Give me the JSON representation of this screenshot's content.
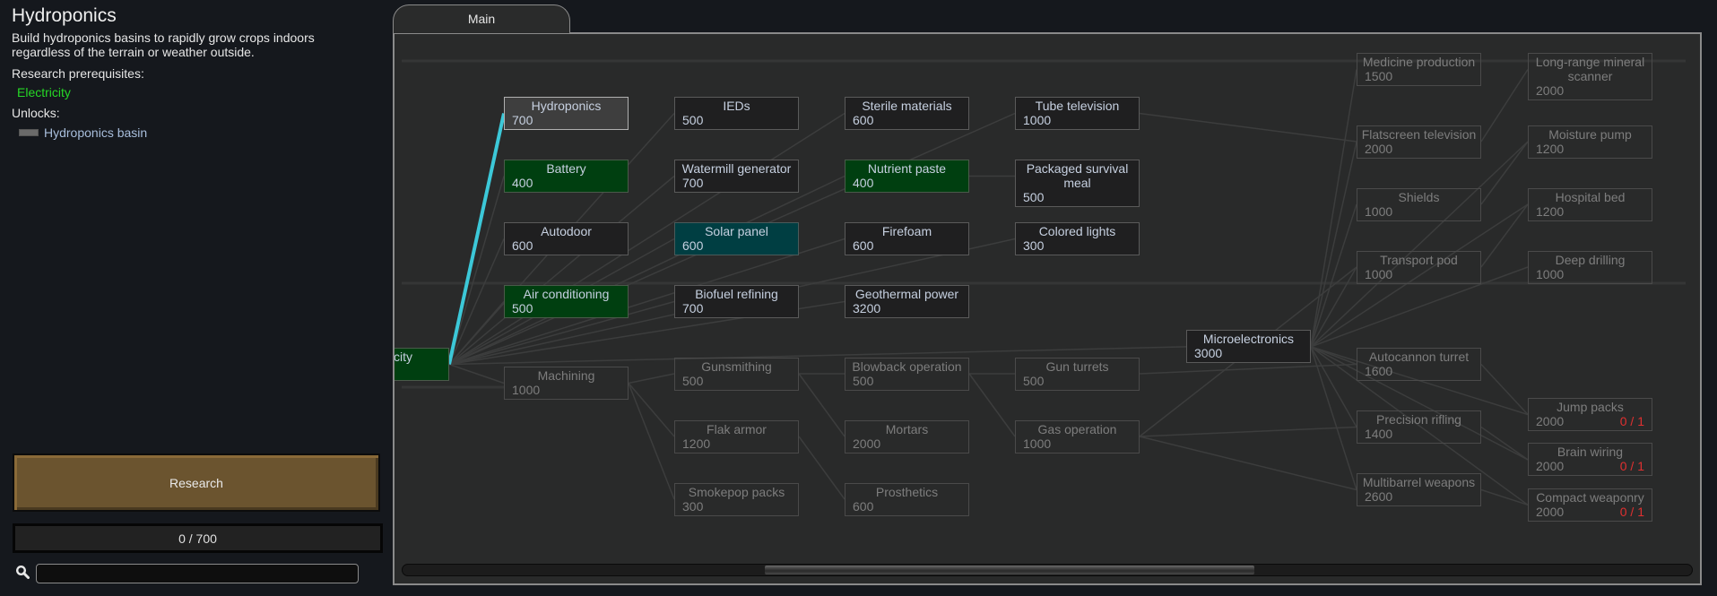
{
  "info": {
    "title": "Hydroponics",
    "description": "Build hydroponics basins to rapidly grow crops indoors regardless of the terrain or weather outside.",
    "prerequisites_label": "Research prerequisites:",
    "prerequisites": [
      "Electricity"
    ],
    "unlocks_label": "Unlocks:",
    "unlocks": [
      "Hydroponics basin"
    ],
    "research_button": "Research",
    "progress_text": "0 / 700",
    "progress_value": 0,
    "progress_max": 700,
    "search_placeholder": "",
    "search_value": ""
  },
  "tabs": [
    {
      "label": "Main",
      "active": true
    }
  ],
  "colors": {
    "prereq_green": "#26d826",
    "done": "#003f10",
    "available_teal": "#003e42",
    "selected": "#3e3e3e",
    "edge": "#3c3d3d",
    "selected_edge": "#3cc8d8",
    "requirement_red": "#e03030",
    "research_button": "#6b542f"
  },
  "scroll": {
    "position_fraction": 0.28,
    "visible_fraction": 0.38
  },
  "nodes": [
    {
      "id": "electricity",
      "label": "Electricity",
      "cost": "",
      "state": "done",
      "col": 0,
      "row": 4.0,
      "clipped": true
    },
    {
      "id": "hydroponics",
      "label": "Hydroponics",
      "cost": "700",
      "state": "selected",
      "col": 1,
      "row": 0
    },
    {
      "id": "battery",
      "label": "Battery",
      "cost": "400",
      "state": "done",
      "col": 1,
      "row": 1
    },
    {
      "id": "autodoor",
      "label": "Autodoor",
      "cost": "600",
      "state": "available",
      "col": 1,
      "row": 2
    },
    {
      "id": "air-conditioning",
      "label": "Air conditioning",
      "cost": "500",
      "state": "done",
      "col": 1,
      "row": 3
    },
    {
      "id": "machining",
      "label": "Machining",
      "cost": "1000",
      "state": "locked",
      "col": 1,
      "row": 4.3
    },
    {
      "id": "ieds",
      "label": "IEDs",
      "cost": "500",
      "state": "available",
      "col": 2,
      "row": 0
    },
    {
      "id": "watermill-generator",
      "label": "Watermill generator",
      "cost": "700",
      "state": "available",
      "col": 2,
      "row": 1
    },
    {
      "id": "solar-panel",
      "label": "Solar panel",
      "cost": "600",
      "state": "active",
      "col": 2,
      "row": 2
    },
    {
      "id": "biofuel-refining",
      "label": "Biofuel refining",
      "cost": "700",
      "state": "available",
      "col": 2,
      "row": 3
    },
    {
      "id": "gunsmithing",
      "label": "Gunsmithing",
      "cost": "500",
      "state": "locked",
      "col": 2,
      "row": 4.15
    },
    {
      "id": "flak-armor",
      "label": "Flak armor",
      "cost": "1200",
      "state": "locked",
      "col": 2,
      "row": 5.15
    },
    {
      "id": "smokepop-packs",
      "label": "Smokepop packs",
      "cost": "300",
      "state": "locked",
      "col": 2,
      "row": 6.15
    },
    {
      "id": "sterile-materials",
      "label": "Sterile materials",
      "cost": "600",
      "state": "available",
      "col": 3,
      "row": 0
    },
    {
      "id": "nutrient-paste",
      "label": "Nutrient paste",
      "cost": "400",
      "state": "done",
      "col": 3,
      "row": 1
    },
    {
      "id": "firefoam",
      "label": "Firefoam",
      "cost": "600",
      "state": "available",
      "col": 3,
      "row": 2
    },
    {
      "id": "geothermal-power",
      "label": "Geothermal power",
      "cost": "3200",
      "state": "available",
      "col": 3,
      "row": 3
    },
    {
      "id": "blowback-operation",
      "label": "Blowback operation",
      "cost": "500",
      "state": "locked",
      "col": 3,
      "row": 4.15
    },
    {
      "id": "mortars",
      "label": "Mortars",
      "cost": "2000",
      "state": "locked",
      "col": 3,
      "row": 5.15
    },
    {
      "id": "prosthetics",
      "label": "Prosthetics",
      "cost": "600",
      "state": "locked",
      "col": 3,
      "row": 6.15
    },
    {
      "id": "tube-television",
      "label": "Tube television",
      "cost": "1000",
      "state": "available",
      "col": 4,
      "row": 0
    },
    {
      "id": "packaged-survival-meal",
      "label": "Packaged survival meal",
      "cost": "500",
      "state": "available",
      "col": 4,
      "row": 1,
      "tall": true
    },
    {
      "id": "colored-lights",
      "label": "Colored lights",
      "cost": "300",
      "state": "available",
      "col": 4,
      "row": 2
    },
    {
      "id": "gun-turrets",
      "label": "Gun turrets",
      "cost": "500",
      "state": "locked",
      "col": 4,
      "row": 4.15
    },
    {
      "id": "gas-operation",
      "label": "Gas operation",
      "cost": "1000",
      "state": "locked",
      "col": 4,
      "row": 5.15
    },
    {
      "id": "microelectronics",
      "label": "Microelectronics",
      "cost": "3000",
      "state": "available",
      "col": 5,
      "row": 3.72
    },
    {
      "id": "medicine-production",
      "label": "Medicine production",
      "cost": "1500",
      "state": "locked",
      "col": 6,
      "row": -0.7
    },
    {
      "id": "flatscreen-television",
      "label": "Flatscreen television",
      "cost": "2000",
      "state": "locked",
      "col": 6,
      "row": 0.45
    },
    {
      "id": "shields",
      "label": "Shields",
      "cost": "1000",
      "state": "locked",
      "col": 6,
      "row": 1.45
    },
    {
      "id": "transport-pod",
      "label": "Transport pod",
      "cost": "1000",
      "state": "locked",
      "col": 6,
      "row": 2.45
    },
    {
      "id": "autocannon-turret",
      "label": "Autocannon turret",
      "cost": "1600",
      "state": "locked",
      "col": 6,
      "row": 4.0
    },
    {
      "id": "precision-rifling",
      "label": "Precision rifling",
      "cost": "1400",
      "state": "locked",
      "col": 6,
      "row": 5.0
    },
    {
      "id": "multibarrel-weapons",
      "label": "Multibarrel weapons",
      "cost": "2600",
      "state": "locked",
      "col": 6,
      "row": 6.0
    },
    {
      "id": "long-range-mineral-scanner",
      "label": "Long-range mineral scanner",
      "cost": "2000",
      "state": "locked",
      "col": 7,
      "row": -0.7,
      "tall": true
    },
    {
      "id": "moisture-pump",
      "label": "Moisture pump",
      "cost": "1200",
      "state": "locked",
      "col": 7,
      "row": 0.45
    },
    {
      "id": "hospital-bed",
      "label": "Hospital bed",
      "cost": "1200",
      "state": "locked",
      "col": 7,
      "row": 1.45
    },
    {
      "id": "deep-drilling",
      "label": "Deep drilling",
      "cost": "1000",
      "state": "locked",
      "col": 7,
      "row": 2.45
    },
    {
      "id": "jump-packs",
      "label": "Jump packs",
      "cost": "2000",
      "state": "locked",
      "col": 7,
      "row": 4.8,
      "requirement": "0 / 1"
    },
    {
      "id": "brain-wiring",
      "label": "Brain wiring",
      "cost": "2000",
      "state": "locked",
      "col": 7,
      "row": 5.52,
      "requirement": "0 / 1"
    },
    {
      "id": "compact-weaponry",
      "label": "Compact weaponry",
      "cost": "2000",
      "state": "locked",
      "col": 7,
      "row": 6.24,
      "requirement": "0 / 1"
    }
  ],
  "edges": [
    [
      "electricity",
      "hydroponics",
      true
    ],
    [
      "electricity",
      "battery"
    ],
    [
      "electricity",
      "autodoor"
    ],
    [
      "electricity",
      "air-conditioning"
    ],
    [
      "electricity",
      "machining"
    ],
    [
      "electricity",
      "ieds"
    ],
    [
      "electricity",
      "watermill-generator"
    ],
    [
      "electricity",
      "solar-panel"
    ],
    [
      "electricity",
      "biofuel-refining"
    ],
    [
      "electricity",
      "sterile-materials"
    ],
    [
      "electricity",
      "nutrient-paste"
    ],
    [
      "electricity",
      "firefoam"
    ],
    [
      "electricity",
      "geothermal-power"
    ],
    [
      "electricity",
      "tube-television"
    ],
    [
      "electricity",
      "colored-lights"
    ],
    [
      "electricity",
      "microelectronics"
    ],
    [
      "nutrient-paste",
      "packaged-survival-meal"
    ],
    [
      "tube-television",
      "flatscreen-television"
    ],
    [
      "machining",
      "gunsmithing"
    ],
    [
      "machining",
      "flak-armor"
    ],
    [
      "machining",
      "smokepop-packs"
    ],
    [
      "gunsmithing",
      "blowback-operation"
    ],
    [
      "gunsmithing",
      "mortars"
    ],
    [
      "flak-armor",
      "prosthetics"
    ],
    [
      "blowback-operation",
      "gun-turrets"
    ],
    [
      "blowback-operation",
      "gas-operation"
    ],
    [
      "gun-turrets",
      "autocannon-turret"
    ],
    [
      "gas-operation",
      "precision-rifling"
    ],
    [
      "gas-operation",
      "multibarrel-weapons"
    ],
    [
      "gas-operation",
      "transport-pod"
    ],
    [
      "microelectronics",
      "medicine-production"
    ],
    [
      "microelectronics",
      "flatscreen-television"
    ],
    [
      "microelectronics",
      "shields"
    ],
    [
      "microelectronics",
      "transport-pod"
    ],
    [
      "microelectronics",
      "autocannon-turret"
    ],
    [
      "microelectronics",
      "precision-rifling"
    ],
    [
      "microelectronics",
      "multibarrel-weapons"
    ],
    [
      "microelectronics",
      "moisture-pump"
    ],
    [
      "microelectronics",
      "hospital-bed"
    ],
    [
      "microelectronics",
      "deep-drilling"
    ],
    [
      "microelectronics",
      "jump-packs"
    ],
    [
      "microelectronics",
      "brain-wiring"
    ],
    [
      "microelectronics",
      "compact-weaponry"
    ],
    [
      "flatscreen-television",
      "long-range-mineral-scanner"
    ],
    [
      "shields",
      "moisture-pump"
    ],
    [
      "transport-pod",
      "hospital-bed"
    ],
    [
      "autocannon-turret",
      "jump-packs"
    ],
    [
      "precision-rifling",
      "brain-wiring"
    ],
    [
      "multibarrel-weapons",
      "compact-weaponry"
    ]
  ]
}
